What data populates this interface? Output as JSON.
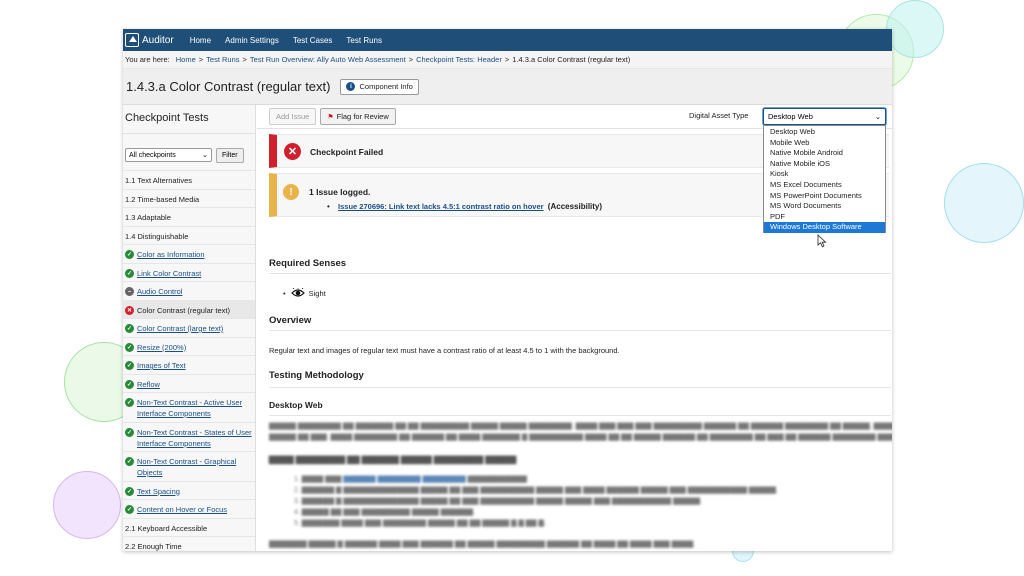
{
  "nav": {
    "logo_text": "Auditor",
    "logo_mark": "fox",
    "items": [
      "Home",
      "Admin Settings",
      "Test Cases",
      "Test Runs"
    ]
  },
  "breadcrumb": {
    "prefix": "You are here:",
    "links": [
      "Home",
      "Test Runs",
      "Test Run Overview: Ally Auto Web Assessment",
      "Checkpoint Tests: Header"
    ],
    "current": "1.4.3.a Color Contrast (regular text)"
  },
  "page": {
    "title": "1.4.3.a Color Contrast (regular text)",
    "component_info": "Component Info"
  },
  "sidebar": {
    "title": "Checkpoint Tests",
    "filter_select": "All checkpoints",
    "filter_button": "Filter",
    "items": [
      {
        "label": "1.1 Text Alternatives",
        "status": "none"
      },
      {
        "label": "1.2 Time-based Media",
        "status": "none"
      },
      {
        "label": "1.3 Adaptable",
        "status": "none"
      },
      {
        "label": "1.4 Distinguishable",
        "status": "none"
      },
      {
        "label": "Color as Information",
        "status": "pass"
      },
      {
        "label": "Link Color Contrast",
        "status": "pass"
      },
      {
        "label": "Audio Control",
        "status": "na"
      },
      {
        "label": "Color Contrast (regular text)",
        "status": "fail"
      },
      {
        "label": "Color Contrast (large text)",
        "status": "pass"
      },
      {
        "label": "Resize (200%)",
        "status": "pass"
      },
      {
        "label": "Images of Text",
        "status": "pass"
      },
      {
        "label": "Reflow",
        "status": "pass"
      },
      {
        "label": "Non-Text Contrast - Active User Interface Components",
        "status": "pass"
      },
      {
        "label": "Non-Text Contrast - States of User Interface Components",
        "status": "pass"
      },
      {
        "label": "Non-Text Contrast - Graphical Objects",
        "status": "pass"
      },
      {
        "label": "Text Spacing",
        "status": "pass"
      },
      {
        "label": "Content on Hover or Focus",
        "status": "pass"
      },
      {
        "label": "2.1 Keyboard Accessible",
        "status": "none"
      },
      {
        "label": "2.2 Enough Time",
        "status": "none"
      }
    ]
  },
  "toolbar": {
    "add_issue": "Add Issue",
    "flag_review": "Flag for Review",
    "digital_asset_label": "Digital Asset Type",
    "digital_asset_value": "Desktop Web",
    "options": [
      "Desktop Web",
      "Mobile Web",
      "Native Mobile Android",
      "Native Mobile iOS",
      "Kiosk",
      "MS Excel Documents",
      "MS PowerPoint Documents",
      "MS Word Documents",
      "PDF",
      "Windows Desktop Software"
    ],
    "highlighted_option": "Windows Desktop Software"
  },
  "status": {
    "failed": "Checkpoint Failed",
    "issues_logged": "1 Issue logged.",
    "issue_link": "Issue 270696: Link text lacks 4.5:1 contrast ratio on hover",
    "issue_category": "(Accessibility)"
  },
  "content": {
    "required_senses": "Required Senses",
    "sense": "Sight",
    "overview": "Overview",
    "overview_text": "Regular text and images of regular text must have a contrast ratio of at least 4.5 to 1 with the background.",
    "testing_methodology": "Testing Methodology",
    "desktop_web": "Desktop Web"
  },
  "colors": {
    "nav": "#1f4e79",
    "fail": "#d0202e",
    "warn": "#e8b44a",
    "pass": "#2a8a3a",
    "link": "#1a4f86",
    "highlight": "#1e78d6"
  }
}
